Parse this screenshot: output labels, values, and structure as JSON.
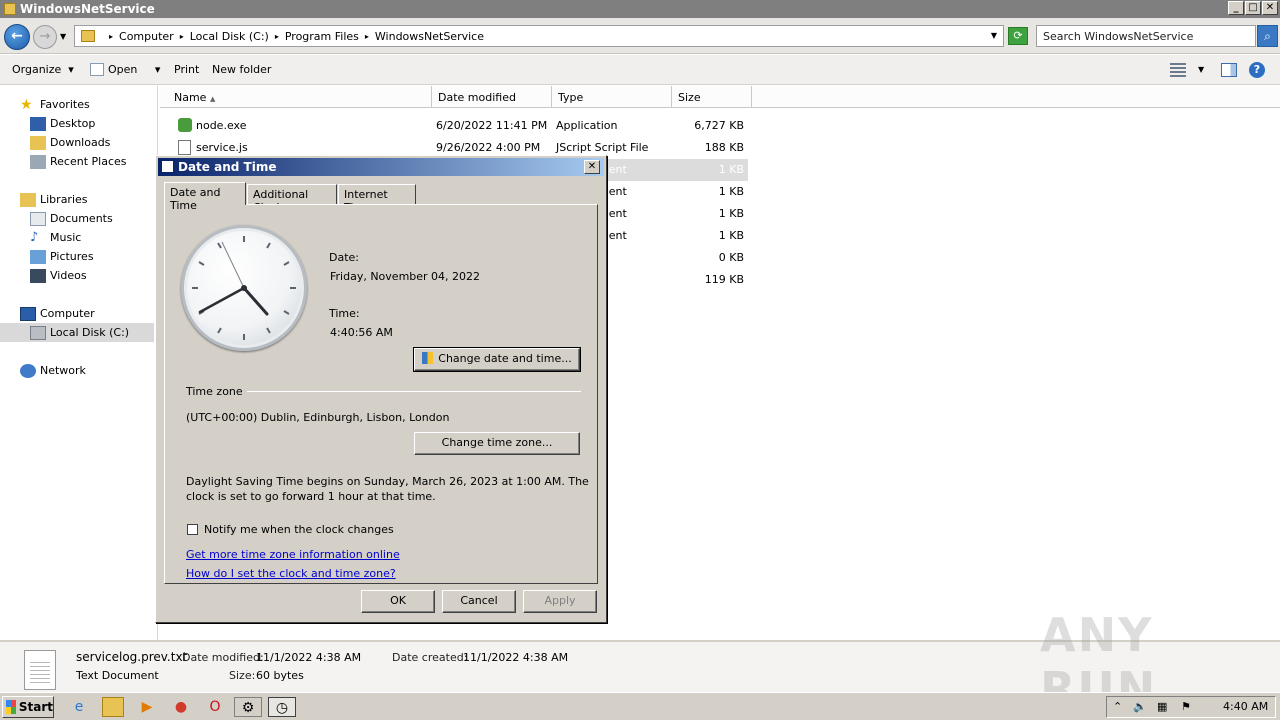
{
  "explorer": {
    "title": "WindowsNetService",
    "breadcrumb": [
      "Computer",
      "Local Disk (C:)",
      "Program Files",
      "WindowsNetService"
    ],
    "search_placeholder": "Search WindowsNetService",
    "toolbar": {
      "organize": "Organize",
      "open": "Open",
      "print": "Print",
      "new_folder": "New folder"
    },
    "nav": {
      "favorites": "Favorites",
      "desktop": "Desktop",
      "downloads": "Downloads",
      "recent": "Recent Places",
      "libraries": "Libraries",
      "documents": "Documents",
      "music": "Music",
      "pictures": "Pictures",
      "videos": "Videos",
      "computer": "Computer",
      "local_disk": "Local Disk (C:)",
      "network": "Network"
    },
    "columns": {
      "name": "Name",
      "date": "Date modified",
      "type": "Type",
      "size": "Size"
    },
    "files": [
      {
        "name": "node.exe",
        "date": "6/20/2022 11:41 PM",
        "type": "Application",
        "size": "6,727 KB"
      },
      {
        "name": "service.js",
        "date": "9/26/2022 4:00 PM",
        "type": "JScript Script File",
        "size": "188 KB"
      },
      {
        "type": "ment",
        "size": "1 KB"
      },
      {
        "type": "ment",
        "size": "1 KB"
      },
      {
        "type": "ment",
        "size": "1 KB"
      },
      {
        "type": "ment",
        "size": "1 KB"
      },
      {
        "size": "0 KB"
      },
      {
        "type": "n",
        "size": "119 KB"
      }
    ],
    "details": {
      "name": "servicelog.prev.txt",
      "kind": "Text Document",
      "modified_label": "Date modified:",
      "modified": "11/1/2022 4:38 AM",
      "created_label": "Date created:",
      "created": "11/1/2022 4:38 AM",
      "size_label": "Size:",
      "size": "60 bytes"
    }
  },
  "dialog": {
    "title": "Date and Time",
    "tabs": [
      "Date and Time",
      "Additional Clocks",
      "Internet Time"
    ],
    "date_label": "Date:",
    "date": "Friday, November 04, 2022",
    "time_label": "Time:",
    "time": "4:40:56 AM",
    "change_dt_button": "Change date and time...",
    "tz_header": "Time zone",
    "tz_value": "(UTC+00:00) Dublin, Edinburgh, Lisbon, London",
    "change_tz_button": "Change time zone...",
    "dst_line1": "Daylight Saving Time begins on Sunday, March 26, 2023 at 1:00 AM. The",
    "dst_line2": "clock is set to go forward 1 hour at that time.",
    "notify_label": "Notify me when the clock changes",
    "notify_checked": false,
    "link1": "Get more time zone information online",
    "link2": "How do I set the clock and time zone?",
    "ok": "OK",
    "cancel": "Cancel",
    "apply": "Apply"
  },
  "taskbar": {
    "start": "Start",
    "clock": "4:40 AM"
  },
  "watermark": "ANY RUN"
}
